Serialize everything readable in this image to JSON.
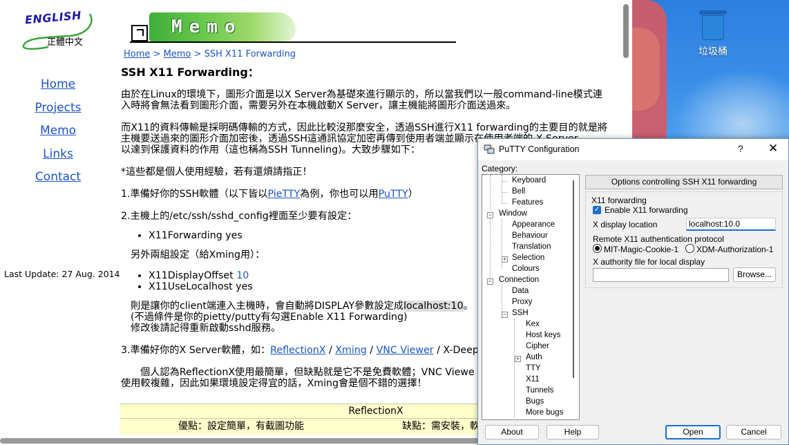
{
  "logo": {
    "english": "ENGLISH",
    "chinese": "正體中文"
  },
  "banner": {
    "title": "Memo"
  },
  "breadcrumb": {
    "home": "Home",
    "sep1": " > ",
    "memo": "Memo",
    "sep2": " > ",
    "current": "SSH X11 Forwarding"
  },
  "sidenav": {
    "items": [
      "Home",
      "Projects",
      "Memo",
      "Links",
      "Contact"
    ]
  },
  "last_update": "Last Update: 27 Aug. 2014",
  "article": {
    "title": "SSH X11 Forwarding：",
    "p1_line1": "由於在Linux的環境下，圖形介面是以X Server為基礎來進行顯示的，所以當我們以一般command-line模式連",
    "p1_line2": "入時將會無法看到圖形介面，需要另外在本機啟動X Server，讓主機能將圖形介面送過來。",
    "p2_line1": "而X11的資料傳輸是採明碼傳輸的方式，因此比較沒那麼安全，透過SSH進行X11 forwarding的主要目的就是將",
    "p2_line2": "主機要送過來的圖形介面加密後，透過SSH這通訊協定加密再傳到使用者端並顯示在使用者端的 X Server，",
    "p2_line3": "以達到保護資料的作用（這也稱為SSH Tunneling)。大致步驟如下：",
    "p3": "*這些都是個人使用經驗，若有還煩請指正！",
    "step1_pre": "1.準備好你的SSH軟體（以下皆以",
    "step1_link1": "PieTTY",
    "step1_mid": "為例，你也可以用",
    "step1_link2": "PuTTY",
    "step1_post": "）",
    "step2": "2.主機上的/etc/ssh/sshd_config裡面至少要有設定：",
    "bullet1": "X11Forwarding yes",
    "other_settings": "另外兩組設定（給Xming用）：",
    "bullet2_key": "X11DisplayOffset ",
    "bullet2_val": "10",
    "bullet3": "X11UseLocalhost yes",
    "note1_pre": "則是讓你的client端連入主機時，會自動將DISPLAY參數設定成",
    "note1_hl": "localhost:10",
    "note1_post": "。",
    "note2": "(不過條件是你的pietty/putty有勾選Enable X11 Forwarding)",
    "note3": "修改後請記得重新啟動sshd服務。",
    "step3_pre": "3.準備好你的X Server軟體，如：",
    "step3_l1": "ReflectionX",
    "step3_s1": " / ",
    "step3_l2": "Xming",
    "step3_s2": " / ",
    "step3_l3": "VNC Viewer",
    "step3_post": " / X-Deep 以",
    "p4_line1": "個人認為ReflectionX使用最簡單，但缺點就是它不是免費軟體；VNC Viewe",
    "p4_line2": "使用較複雜，因此如果環境設定得宜的話，Xming會是個不錯的選擇！"
  },
  "table": {
    "header": "ReflectionX",
    "pros": "優點：設定簡單，有截圖功能",
    "cons": "缺點：需安裝，軟"
  },
  "desktop": {
    "recycle_bin": "垃圾桶"
  },
  "putty": {
    "title": "PuTTY Configuration",
    "help": "?",
    "close": "✕",
    "category_label": "Category:",
    "tree": {
      "keyboard": "Keyboard",
      "bell": "Bell",
      "features": "Features",
      "window": "Window",
      "appearance": "Appearance",
      "behaviour": "Behaviour",
      "translation": "Translation",
      "selection": "Selection",
      "colours": "Colours",
      "connection": "Connection",
      "data": "Data",
      "proxy": "Proxy",
      "ssh": "SSH",
      "kex": "Kex",
      "hostkeys": "Host keys",
      "cipher": "Cipher",
      "auth": "Auth",
      "tty": "TTY",
      "x11": "X11",
      "tunnels": "Tunnels",
      "bugs": "Bugs",
      "morebugs": "More bugs"
    },
    "panel_header": "Options controlling SSH X11 forwarding",
    "group_title": "X11 forwarding",
    "enable_x11": "Enable X11 forwarding",
    "display_label": "X display location",
    "display_value": "localhost:10.0",
    "auth_label": "Remote X11 authentication protocol",
    "auth_opt1": "MIT-Magic-Cookie-1",
    "auth_opt2": "XDM-Authorization-1",
    "xauth_label": "X authority file for local display",
    "xauth_value": "",
    "browse": "Browse...",
    "about": "About",
    "help_btn": "Help",
    "open": "Open",
    "cancel": "Cancel"
  }
}
